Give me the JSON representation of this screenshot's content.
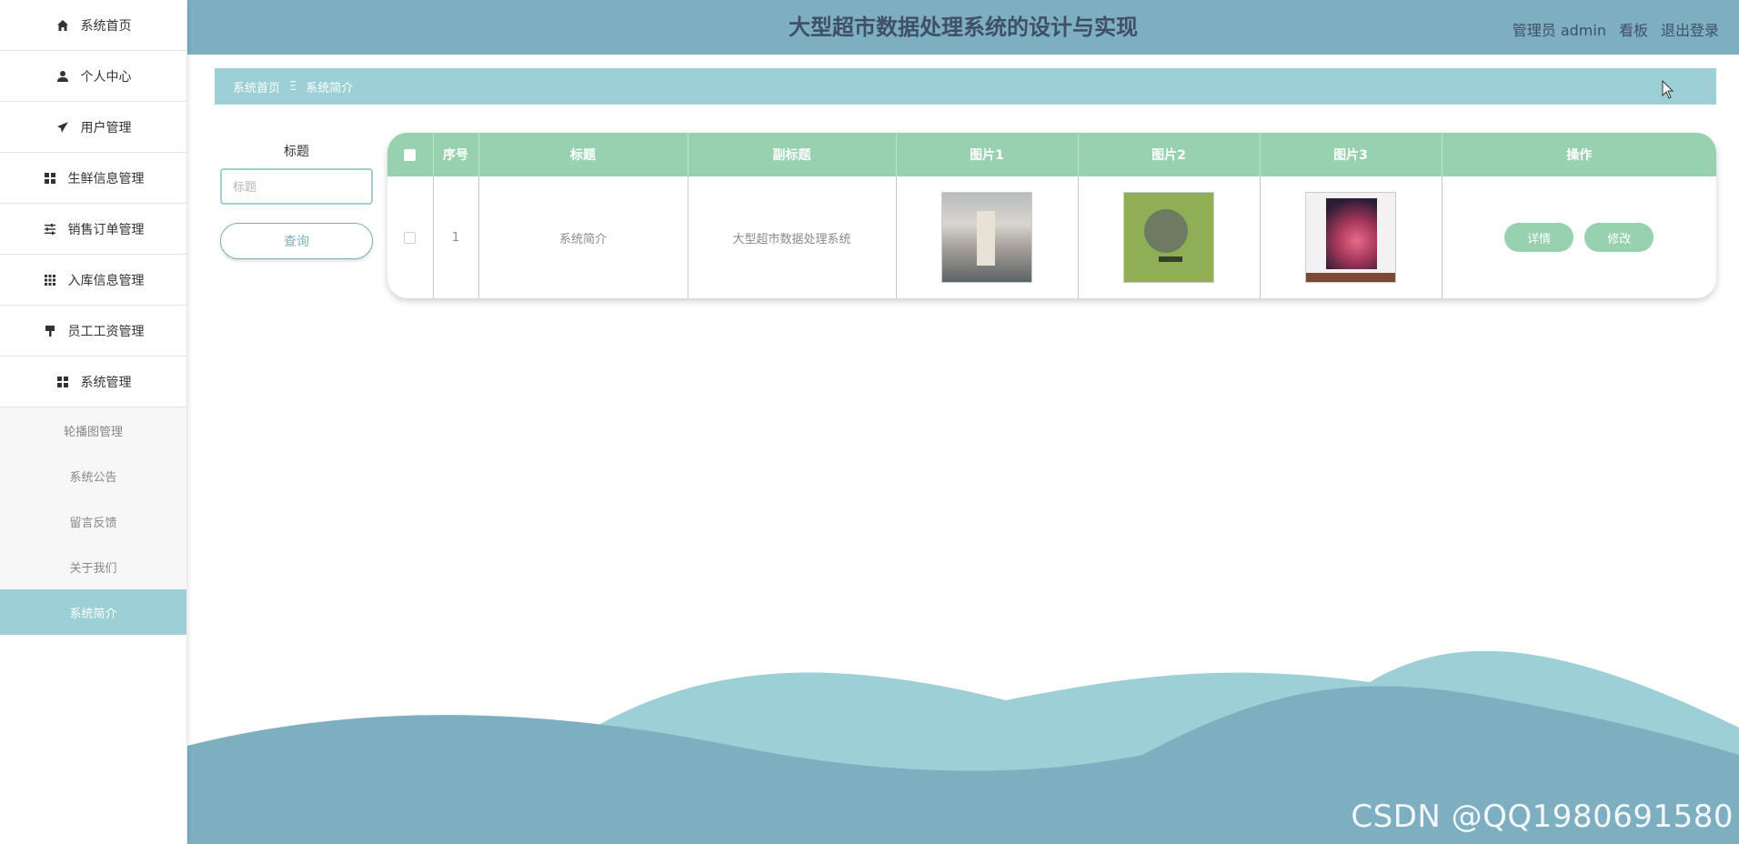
{
  "sidebar": {
    "items": [
      {
        "label": "系统首页",
        "icon": "home-icon"
      },
      {
        "label": "个人中心",
        "icon": "user-icon"
      },
      {
        "label": "用户管理",
        "icon": "paper-plane-icon"
      },
      {
        "label": "生鲜信息管理",
        "icon": "grid-icon"
      },
      {
        "label": "销售订单管理",
        "icon": "sliders-icon"
      },
      {
        "label": "入库信息管理",
        "icon": "apps-icon"
      },
      {
        "label": "员工工资管理",
        "icon": "brush-icon"
      },
      {
        "label": "系统管理",
        "icon": "grid-icon"
      }
    ],
    "sub_items": [
      {
        "label": "轮播图管理",
        "active": false
      },
      {
        "label": "系统公告",
        "active": false
      },
      {
        "label": "留言反馈",
        "active": false
      },
      {
        "label": "关于我们",
        "active": false
      },
      {
        "label": "系统简介",
        "active": true
      }
    ]
  },
  "header": {
    "title": "大型超市数据处理系统的设计与实现",
    "user": "管理员 admin",
    "dashboard": "看板",
    "logout": "退出登录"
  },
  "breadcrumb": {
    "home": "系统首页",
    "separator": "Ξ",
    "current": "系统简介"
  },
  "search": {
    "label": "标题",
    "placeholder": "标题",
    "button": "查询"
  },
  "table": {
    "headers": [
      "序号",
      "标题",
      "副标题",
      "图片1",
      "图片2",
      "图片3",
      "操作"
    ],
    "rows": [
      {
        "index": "1",
        "title": "系统简介",
        "subtitle": "大型超市数据处理系统",
        "detail": "详情",
        "edit": "修改"
      }
    ]
  },
  "watermark": "CSDN @QQ1980691580",
  "colors": {
    "primary": "#7eafc0",
    "accent": "#9ccfd6",
    "table_header": "#97d1b0"
  }
}
